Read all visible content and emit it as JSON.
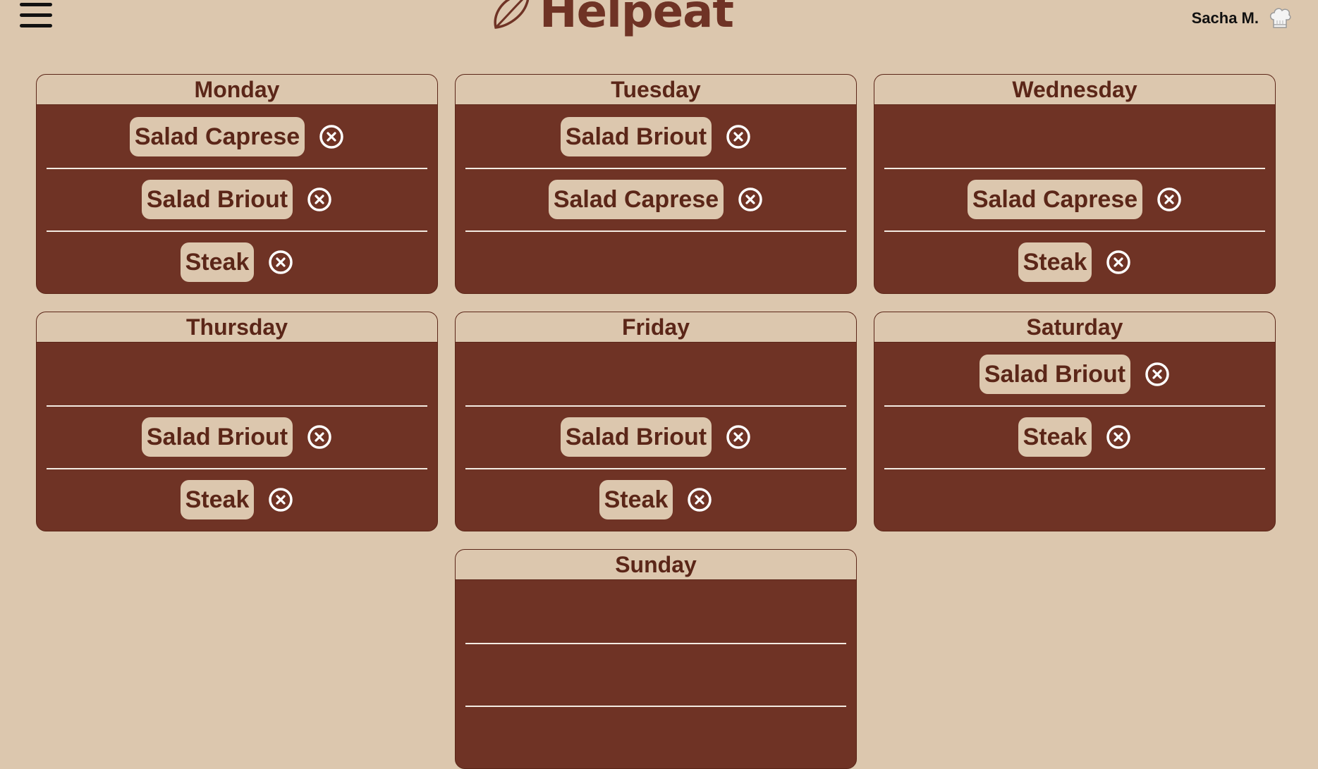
{
  "header": {
    "logo_text": "Helpeat",
    "user_name": "Sacha M."
  },
  "colors": {
    "background": "#dcc7ae",
    "card": "#6f3325",
    "text": "#5b2618"
  },
  "icons": {
    "menu": "hamburger-icon",
    "logo": "leaf-icon",
    "user": "chef-hat-icon",
    "remove": "close-circle-icon"
  },
  "days": [
    {
      "name": "Monday",
      "slots": [
        "Salad Caprese",
        "Salad Briout",
        "Steak"
      ]
    },
    {
      "name": "Tuesday",
      "slots": [
        "Salad Briout",
        "Salad Caprese",
        ""
      ]
    },
    {
      "name": "Wednesday",
      "slots": [
        "",
        "Salad Caprese",
        "Steak"
      ]
    },
    {
      "name": "Thursday",
      "slots": [
        "",
        "Salad Briout",
        "Steak"
      ]
    },
    {
      "name": "Friday",
      "slots": [
        "",
        "Salad Briout",
        "Steak"
      ]
    },
    {
      "name": "Saturday",
      "slots": [
        "Salad Briout",
        "Steak",
        ""
      ]
    },
    {
      "name": "Sunday",
      "slots": [
        "",
        "",
        ""
      ]
    }
  ]
}
